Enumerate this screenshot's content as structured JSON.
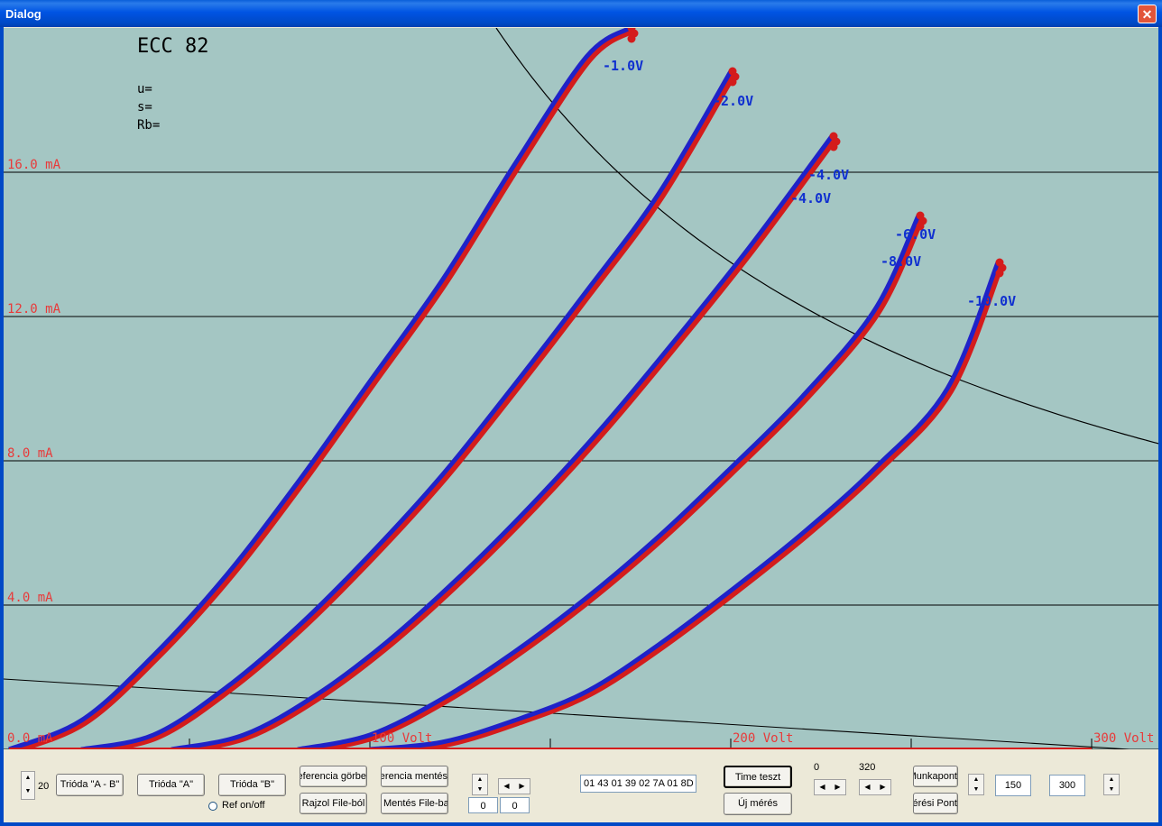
{
  "window": {
    "title": "Dialog",
    "close_label": "✕"
  },
  "plot": {
    "tube_name": "ECC 82",
    "params": {
      "u": "u=",
      "s": "s=",
      "rb": "Rb="
    },
    "y_labels": [
      "16.0 mA",
      "12.0 mA",
      "8.0 mA",
      "4.0 mA",
      "0.0 mA"
    ],
    "x_labels": [
      "100 Volt",
      "200 Volt",
      "300 Volt"
    ],
    "curve_labels": [
      "-1.0V",
      "-2.0V",
      "-4.0V",
      "-6.0V",
      "-8.0V",
      "-10.0V"
    ],
    "colors": {
      "background": "#A4C6C3",
      "blue": "#1F22C8",
      "red": "#D41C1C",
      "axis_text": "#E83A3A"
    }
  },
  "chart_data": {
    "type": "line",
    "title": "ECC 82",
    "xlabel": "Volt",
    "ylabel": "mA",
    "xlim": [
      0,
      300
    ],
    "ylim": [
      0,
      16
    ],
    "grid": true,
    "series": [
      {
        "name": "-1.0V",
        "x": [
          0,
          20,
          40,
          60,
          80,
          100,
          120,
          140,
          160,
          172
        ],
        "y": [
          0,
          0.8,
          2.6,
          4.8,
          7.4,
          10.2,
          13.0,
          16.2,
          19.2,
          20.0
        ]
      },
      {
        "name": "-2.0V",
        "x": [
          20,
          40,
          60,
          80,
          100,
          120,
          140,
          160,
          180,
          200
        ],
        "y": [
          0,
          0.4,
          1.7,
          3.4,
          5.4,
          7.6,
          10.1,
          12.7,
          15.4,
          18.8
        ]
      },
      {
        "name": "-4.0V",
        "x": [
          45,
          65,
          85,
          105,
          125,
          145,
          165,
          185,
          205,
          228
        ],
        "y": [
          0,
          0.4,
          1.5,
          3.0,
          4.8,
          6.8,
          9.0,
          11.4,
          13.9,
          17.0
        ]
      },
      {
        "name": "-6.0V",
        "x": [
          80,
          100,
          120,
          140,
          160,
          180,
          200,
          220,
          240,
          252
        ],
        "y": [
          0,
          0.4,
          1.4,
          2.7,
          4.2,
          5.9,
          7.8,
          9.8,
          12.2,
          14.8
        ]
      },
      {
        "name": "-8.0V",
        "x": [
          100,
          120,
          140,
          160,
          180,
          200,
          220,
          240,
          260,
          274
        ],
        "y": [
          0,
          0.2,
          0.8,
          1.6,
          2.9,
          4.4,
          6.0,
          7.8,
          10.0,
          13.5
        ]
      }
    ]
  },
  "controls": {
    "spin_value": "20",
    "trioda_ab": "Trióda \"A - B\"",
    "trioda_a": "Trióda  \"A\"",
    "trioda_b": "Trióda  \"B\"",
    "ref_toggle": "Ref on/off",
    "ref_curve_btn": "Referencia görbe",
    "ref_save_btn": "Referencia mentés",
    "draw_file_btn": "Rajzol File-ból",
    "save_file_btn": "Mentés File-ba",
    "field_a": "0",
    "field_b": "0",
    "hex_field": "01 43 01 39 02 7A 01 8D",
    "time_test": "Time teszt",
    "new_measure": "Új mérés",
    "range_min": "0",
    "range_max": "320",
    "work_point": "Munkapont",
    "measure_point": "Mérési Pont",
    "value1": "150",
    "value2": "300"
  }
}
